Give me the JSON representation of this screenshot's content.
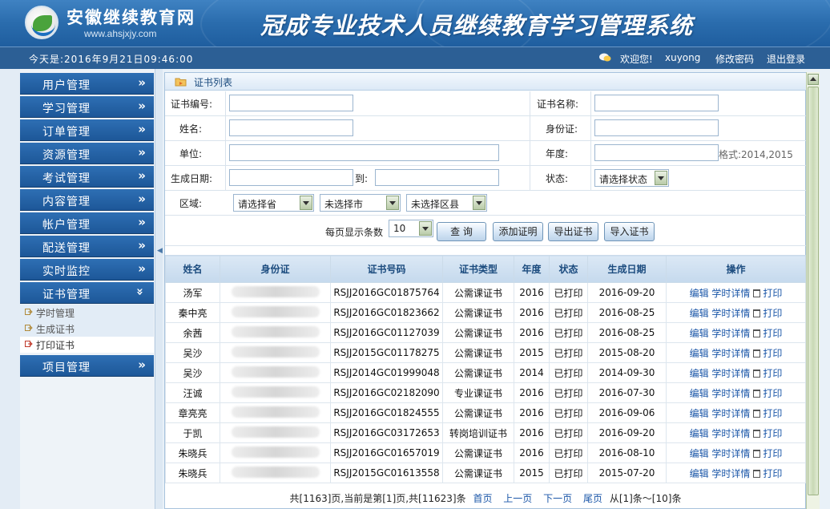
{
  "header": {
    "site_name": "安徽继续教育网",
    "site_url": "www.ahsjxjy.com",
    "system_title": "冠成专业技术人员继续教育学习管理系统"
  },
  "infobar": {
    "date_text": "今天是:2016年9月21日09:46:00",
    "welcome": "欢迎您!",
    "username": "xuyong",
    "change_password": "修改密码",
    "logout": "退出登录"
  },
  "sidebar": {
    "menus": [
      {
        "label": "用户管理",
        "arrow": "»"
      },
      {
        "label": "学习管理",
        "arrow": "»"
      },
      {
        "label": "订单管理",
        "arrow": "»"
      },
      {
        "label": "资源管理",
        "arrow": "»"
      },
      {
        "label": "考试管理",
        "arrow": "»"
      },
      {
        "label": "内容管理",
        "arrow": "»"
      },
      {
        "label": "帐户管理",
        "arrow": "»"
      },
      {
        "label": "配送管理",
        "arrow": "»"
      },
      {
        "label": "实时监控",
        "arrow": "»"
      },
      {
        "label": "证书管理",
        "arrow": "»"
      }
    ],
    "sub_items": [
      {
        "label": "学时管理"
      },
      {
        "label": "生成证书"
      },
      {
        "label": "打印证书"
      }
    ],
    "last_menu": {
      "label": "项目管理",
      "arrow": "»"
    }
  },
  "panel": {
    "title": "证书列表"
  },
  "form": {
    "cert_no_label": "证书编号:",
    "cert_name_label": "证书名称:",
    "name_label": "姓名:",
    "id_label": "身份证:",
    "unit_label": "单位:",
    "year_label": "年度:",
    "year_hint": "格式:2014,2015",
    "gen_date_label": "生成日期:",
    "to_label": "到:",
    "status_label": "状态:",
    "status_value": "请选择状态",
    "region_label": "区域:",
    "province_value": "请选择省",
    "city_value": "未选择市",
    "district_value": "未选择区县",
    "page_size_label": "每页显示条数",
    "page_size_value": "10",
    "query_btn": "查 询",
    "add_btn": "添加证明",
    "export_btn": "导出证书",
    "import_btn": "导入证书"
  },
  "table": {
    "columns": [
      "姓名",
      "身份证",
      "证书号码",
      "证书类型",
      "年度",
      "状态",
      "生成日期",
      "操作"
    ],
    "op_labels": {
      "edit": "编辑",
      "detail": "学时详情",
      "print": "打印"
    },
    "rows": [
      {
        "name": "汤军",
        "cert_no": "RSJJ2016GC01875764",
        "type": "公需课证书",
        "year": "2016",
        "status": "已打印",
        "date": "2016-09-20"
      },
      {
        "name": "秦中亮",
        "cert_no": "RSJJ2016GC01823662",
        "type": "公需课证书",
        "year": "2016",
        "status": "已打印",
        "date": "2016-08-25"
      },
      {
        "name": "余茜",
        "cert_no": "RSJJ2016GC01127039",
        "type": "公需课证书",
        "year": "2016",
        "status": "已打印",
        "date": "2016-08-25"
      },
      {
        "name": "吴沙",
        "cert_no": "RSJJ2015GC01178275",
        "type": "公需课证书",
        "year": "2015",
        "status": "已打印",
        "date": "2015-08-20"
      },
      {
        "name": "吴沙",
        "cert_no": "RSJJ2014GC01999048",
        "type": "公需课证书",
        "year": "2014",
        "status": "已打印",
        "date": "2014-09-30"
      },
      {
        "name": "汪诚",
        "cert_no": "RSJJ2016GC02182090",
        "type": "专业课证书",
        "year": "2016",
        "status": "已打印",
        "date": "2016-07-30"
      },
      {
        "name": "章亮亮",
        "cert_no": "RSJJ2016GC01824555",
        "type": "公需课证书",
        "year": "2016",
        "status": "已打印",
        "date": "2016-09-06"
      },
      {
        "name": "于凯",
        "cert_no": "RSJJ2016GC03172653",
        "type": "转岗培训证书",
        "year": "2016",
        "status": "已打印",
        "date": "2016-09-20"
      },
      {
        "name": "朱晓兵",
        "cert_no": "RSJJ2016GC01657019",
        "type": "公需课证书",
        "year": "2016",
        "status": "已打印",
        "date": "2016-08-10"
      },
      {
        "name": "朱晓兵",
        "cert_no": "RSJJ2015GC01613558",
        "type": "公需课证书",
        "year": "2015",
        "status": "已打印",
        "date": "2015-07-20"
      }
    ]
  },
  "pager": {
    "summary": "共[1163]页,当前是第[1]页,共[11623]条",
    "first": "首页",
    "prev": "上一页",
    "next": "下一页",
    "last": "尾页",
    "range": "从[1]条～[10]条"
  },
  "colors": {
    "header_blue": "#2a6cad",
    "menu_blue": "#1d5798",
    "link_blue": "#1a56a8",
    "table_head": "#c5d9ed"
  }
}
